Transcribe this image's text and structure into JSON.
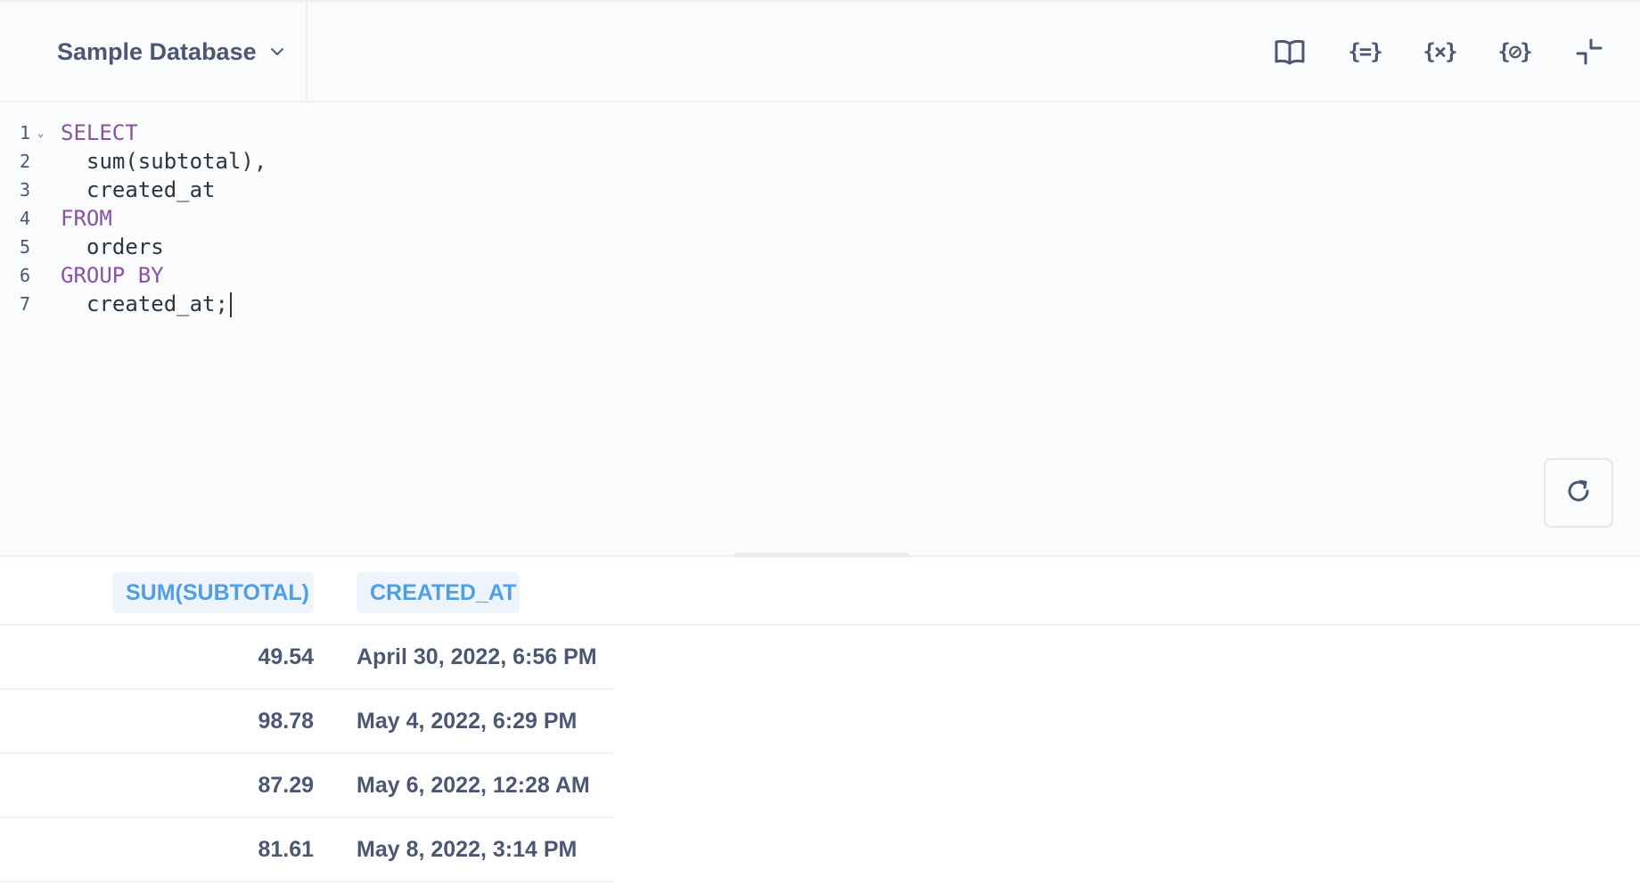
{
  "header": {
    "database": "Sample Database"
  },
  "toolbar": {
    "icons": [
      "book-icon",
      "snippet-icon",
      "variable-icon",
      "snippet-alt-icon",
      "collapse-icon"
    ],
    "snippets_label": "{=}",
    "variables_label": "{×}",
    "preview_label": "{⊘}"
  },
  "editor": {
    "lines": [
      {
        "num": "1",
        "text": "SELECT"
      },
      {
        "num": "2",
        "text": "sum(subtotal),"
      },
      {
        "num": "3",
        "text": "created_at"
      },
      {
        "num": "4",
        "text": "FROM"
      },
      {
        "num": "5",
        "text": "orders"
      },
      {
        "num": "6",
        "text": "GROUP BY"
      },
      {
        "num": "7",
        "text": "created_at;"
      }
    ],
    "keyword_color": "#8A51A4"
  },
  "results": {
    "columns": [
      "SUM(SUBTOTAL)",
      "CREATED_AT"
    ],
    "rows": [
      {
        "sum": "49.54",
        "created_at": "April 30, 2022, 6:56 PM"
      },
      {
        "sum": "98.78",
        "created_at": "May 4, 2022, 6:29 PM"
      },
      {
        "sum": "87.29",
        "created_at": "May 6, 2022, 12:28 AM"
      },
      {
        "sum": "81.61",
        "created_at": "May 8, 2022, 3:14 PM"
      }
    ],
    "header_color": "#509EE3"
  }
}
